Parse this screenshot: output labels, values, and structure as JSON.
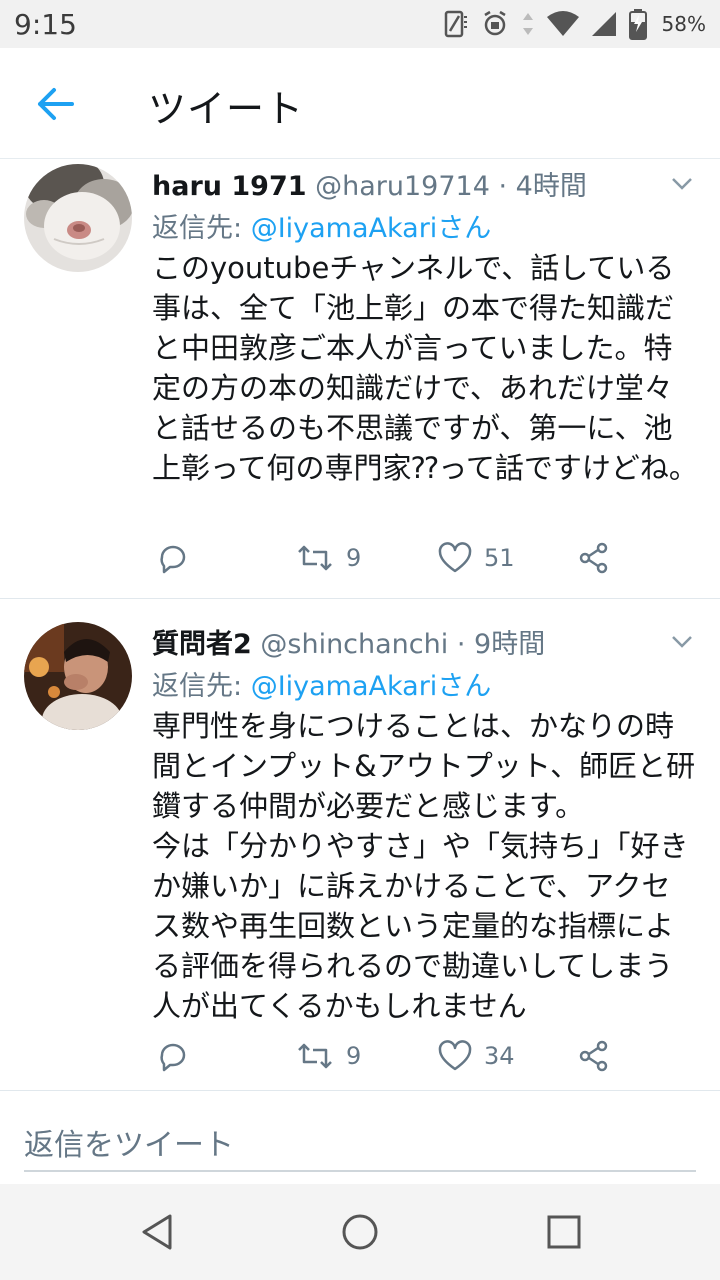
{
  "status_bar": {
    "time": "9:15",
    "battery_percent": "58%",
    "icons": [
      "screen-rotate-icon",
      "alarm-icon",
      "data-arrows-icon",
      "wifi-icon",
      "signal-icon",
      "battery-icon"
    ]
  },
  "header": {
    "back_icon": "arrow-left-icon",
    "title": "ツイート"
  },
  "colors": {
    "accent": "#1da1f2",
    "secondary_text": "#657786",
    "divider": "#e1e8ed"
  },
  "tweets": [
    {
      "name": "haru 1971",
      "handle": "@haru19714",
      "separator": " · ",
      "time": "4時間",
      "reply_prefix": "返信先: ",
      "reply_mention": "@IiyamaAkari",
      "reply_suffix": "さん",
      "body": "このyoutubeチャンネルで、話している事は、全て「池上彰」の本で得た知識だと中田敦彦ご本人が言っていました。特定の方の本の知識だけで、あれだけ堂々と話せるのも不思議ですが、第一に、池上彰って何の専門家⁇って話ですけどね。",
      "retweets": "9",
      "likes": "51"
    },
    {
      "name": "質問者2",
      "handle": "@shinchanchi",
      "separator": " · ",
      "time": "9時間",
      "reply_prefix": "返信先: ",
      "reply_mention": "@IiyamaAkari",
      "reply_suffix": "さん",
      "body": "専門性を身につけることは、かなりの時間とインプット&アウトプット、師匠と研鑽する仲間が必要だと感じます。\n今は「分かりやすさ」や「気持ち」「好きか嫌いか」に訴えかけることで、アクセス数や再生回数という定量的な指標による評価を得られるので勘違いしてしまう人が出てくるかもしれません",
      "retweets": "9",
      "likes": "34"
    }
  ],
  "composer": {
    "placeholder": "返信をツイート"
  },
  "nav_bar": {
    "buttons": [
      "back-triangle-icon",
      "home-circle-icon",
      "recents-square-icon"
    ]
  }
}
